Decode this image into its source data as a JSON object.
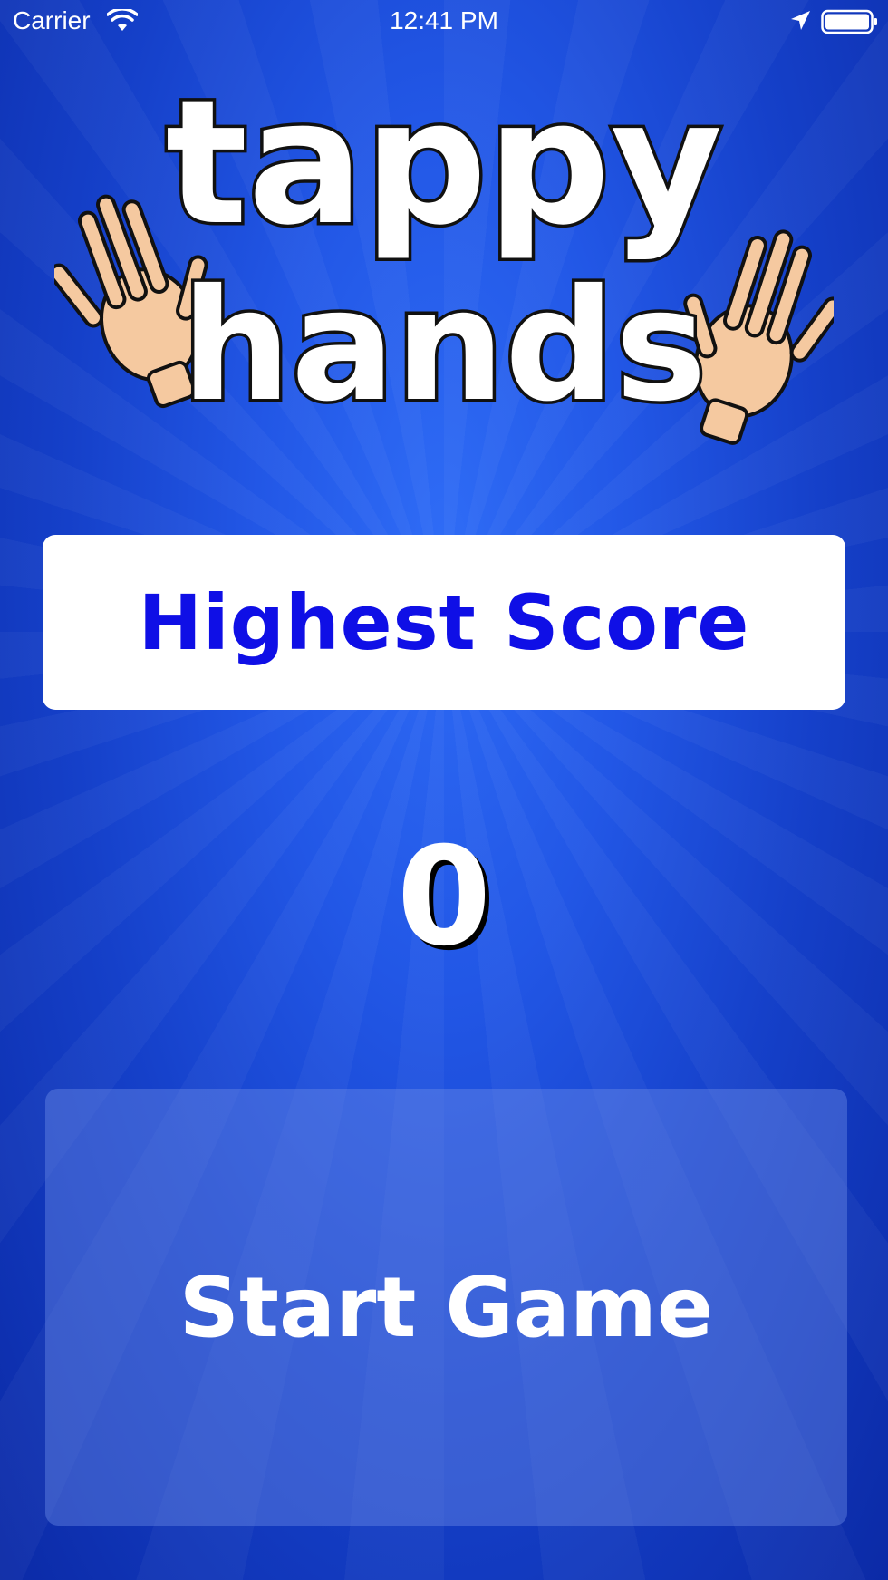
{
  "status_bar": {
    "carrier": "Carrier",
    "time": "12:41 PM",
    "icons": [
      "wifi-icon",
      "location-arrow-icon",
      "battery-icon"
    ]
  },
  "logo": {
    "line1": "tappy",
    "line2": "hands",
    "icons": [
      "left-hand-icon",
      "right-hand-icon"
    ]
  },
  "score": {
    "label": "Highest Score",
    "value": "0"
  },
  "start_button": {
    "label": "Start Game"
  },
  "colors": {
    "background": "#2257e6",
    "label_blue": "#0f0fe6",
    "hand_skin": "#f5c9a0"
  }
}
